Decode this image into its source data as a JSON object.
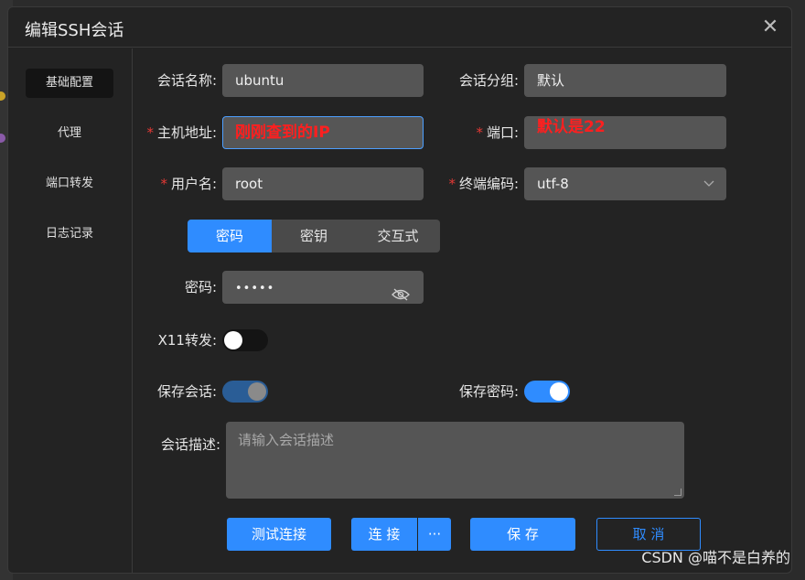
{
  "dialog": {
    "title": "编辑SSH会话",
    "close_glyph": "✕"
  },
  "sidebar": {
    "items": [
      {
        "label": "基础配置",
        "active": true
      },
      {
        "label": "代理",
        "active": false
      },
      {
        "label": "端口转发",
        "active": false
      },
      {
        "label": "日志记录",
        "active": false
      }
    ]
  },
  "form": {
    "session_name": {
      "label": "会话名称:",
      "value": "ubuntu"
    },
    "session_group": {
      "label": "会话分组:",
      "value": "默认"
    },
    "host": {
      "label": "主机地址:",
      "value": "刚刚查到的IP",
      "required": true
    },
    "port": {
      "label": "端口:",
      "value": "默认是22",
      "required": true
    },
    "username": {
      "label": "用户名:",
      "value": "root",
      "required": true
    },
    "encoding": {
      "label": "终端编码:",
      "value": "utf-8",
      "required": true
    },
    "auth_tabs": [
      "密码",
      "密钥",
      "交互式"
    ],
    "auth_active": "密码",
    "password": {
      "label": "密码:",
      "value": "•••••"
    },
    "x11": {
      "label": "X11转发:",
      "on": false
    },
    "save_session": {
      "label": "保存会话:",
      "on": true
    },
    "save_password": {
      "label": "保存密码:",
      "on": true
    },
    "description": {
      "label": "会话描述:",
      "placeholder": "请输入会话描述"
    }
  },
  "buttons": {
    "test": "测试连接",
    "connect": "连 接",
    "more": "···",
    "save": "保 存",
    "cancel": "取 消"
  },
  "colors": {
    "accent": "#2f8cff",
    "required": "#e53935",
    "annotation": "#ff1f1f"
  },
  "watermark": "CSDN @喵不是白养的"
}
